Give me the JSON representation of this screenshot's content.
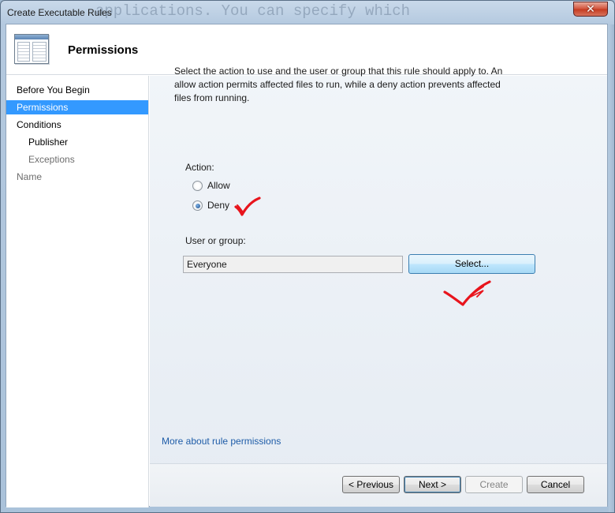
{
  "window": {
    "title": "Create Executable Rules",
    "background_text": "applications. You can specify which",
    "close_symbol": "✕"
  },
  "header": {
    "title": "Permissions"
  },
  "nav": {
    "items": [
      {
        "label": "Before You Begin"
      },
      {
        "label": "Permissions"
      },
      {
        "label": "Conditions"
      },
      {
        "label": "Publisher"
      },
      {
        "label": "Exceptions"
      },
      {
        "label": "Name"
      }
    ]
  },
  "main": {
    "description": "Select the action to use and the user or group that this rule should apply to. An allow action permits affected files to run, while a deny action prevents affected files from running.",
    "action_label": "Action:",
    "allow_label": "Allow",
    "deny_label": "Deny",
    "selected_action": "Deny",
    "user_group_label": "User or group:",
    "user_group_value": "Everyone",
    "select_button": "Select...",
    "more_link": "More about rule permissions"
  },
  "footer": {
    "previous": "< Previous",
    "next": "Next >",
    "create": "Create",
    "cancel": "Cancel"
  },
  "colors": {
    "selection": "#3399ff",
    "link": "#1e5ca8",
    "annotation": "#e8141c"
  },
  "icons": {
    "header": "wizard-window-icon",
    "close": "close-icon",
    "annotation": "check-mark-icon"
  }
}
